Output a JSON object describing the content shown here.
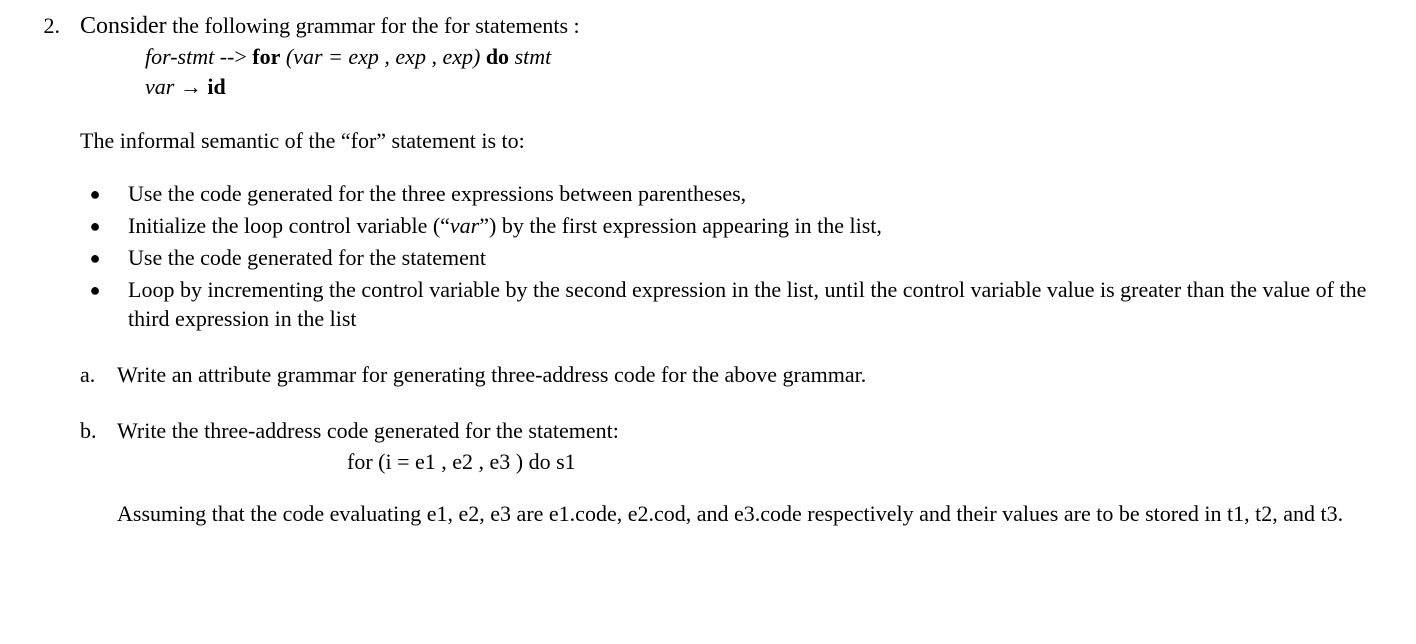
{
  "question": {
    "number": "2.",
    "intro_consider": "Consider",
    "intro_rest": " the following grammar for the for statements :",
    "grammar": {
      "line1_lhs": "for-stmt",
      "line1_arrow": " --> ",
      "line1_for": "for",
      "line1_paren": "  (var = exp , exp , exp)",
      "line1_do": "  do",
      "line1_stmt": "  stmt",
      "line2_lhs": "var",
      "line2_arrow": " → ",
      "line2_rhs": "id"
    },
    "informal_pre": "The informal semantic of the “for” statement is to:",
    "bullets": [
      "Use the code generated for the three expressions between parentheses,",
      "Initialize the loop control variable (“var”) by the first expression appearing in the list,",
      "Use the code generated for  the statement",
      "Loop by incrementing the control variable by the second expression in the list, until  the control variable value is greater than the value of the third expression in the list"
    ],
    "bullet2_pre": "Initialize the loop control variable (“",
    "bullet2_var": "var",
    "bullet2_post": "”) by the first expression appearing in the list,",
    "parts": {
      "a_label": "a.",
      "a_text": "Write an attribute grammar for generating three-address code for the above grammar.",
      "b_label": "b.",
      "b_text": "Write the three-address code generated for the statement:",
      "b_code": "for (i = e1 , e2 , e3 ) do s1",
      "b_assume": "Assuming that the code evaluating e1, e2, e3 are e1.code, e2.cod, and e3.code respectively and their values are to be stored in t1, t2, and t3."
    }
  }
}
